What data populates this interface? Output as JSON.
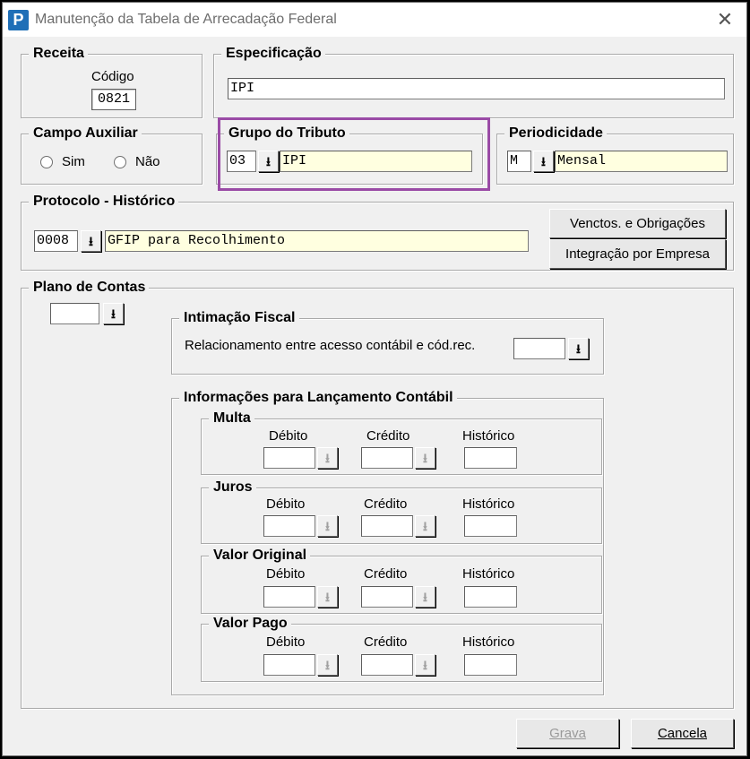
{
  "window": {
    "title": "Manutenção da Tabela de Arrecadação Federal",
    "icon_letter": "P",
    "close_glyph": "✕"
  },
  "receita": {
    "legend": "Receita",
    "codigo_label": "Código",
    "codigo_value": "0821"
  },
  "especificacao": {
    "legend": "Especificação",
    "value": "IPI"
  },
  "campo_auxiliar": {
    "legend": "Campo Auxiliar",
    "sim_label": "Sim",
    "nao_label": "Não"
  },
  "grupo_tributo": {
    "legend": "Grupo do Tributo",
    "code": "03",
    "description": "IPI"
  },
  "periodicidade": {
    "legend": "Periodicidade",
    "code": "M",
    "description": "Mensal"
  },
  "protocolo": {
    "legend": "Protocolo - Histórico",
    "code": "0008",
    "description": "GFIP para Recolhimento"
  },
  "buttons": {
    "venctos": "Venctos. e Obrigações",
    "integracao": "Integração por Empresa",
    "grava": "Grava",
    "cancela": "Cancela"
  },
  "plano_contas": {
    "legend": "Plano de Contas",
    "value": ""
  },
  "intimacao": {
    "legend": "Intimação Fiscal",
    "label": "Relacionamento entre acesso contábil e cód.rec.",
    "value": ""
  },
  "lancamento": {
    "legend": "Informações para Lançamento Contábil",
    "column_labels": {
      "debito": "Débito",
      "credito": "Crédito",
      "historico": "Histórico"
    },
    "sections": [
      {
        "legend": "Multa"
      },
      {
        "legend": "Juros"
      },
      {
        "legend": "Valor Original"
      },
      {
        "legend": "Valor Pago"
      }
    ]
  },
  "icons": {
    "dropdown": "download-arrow-icon",
    "close": "close-icon",
    "app": "app-logo-icon"
  },
  "colors": {
    "highlight_border": "#9a4ba6",
    "readonly_field": "#ffffe0",
    "brand": "#1f6fb7"
  }
}
